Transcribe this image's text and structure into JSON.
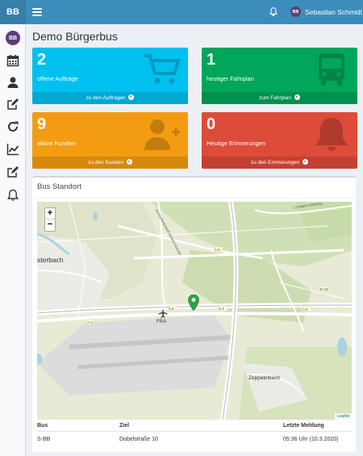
{
  "app": {
    "brand": "BB"
  },
  "topbar": {
    "user_initials": "BB",
    "user_name": "Sebastian Schmidt"
  },
  "sidebar": {
    "avatar_initials": "BB",
    "items": [
      {
        "icon": "calendar-icon"
      },
      {
        "icon": "user-icon"
      },
      {
        "icon": "edit-icon"
      },
      {
        "icon": "refresh-icon"
      },
      {
        "icon": "line-chart-icon"
      },
      {
        "icon": "edit-icon"
      },
      {
        "icon": "bell-icon"
      }
    ]
  },
  "page": {
    "title": "Demo Bürgerbus"
  },
  "boxes": [
    {
      "count": "2",
      "label": "offene Aufträge",
      "link": "zu den Aufträgen",
      "color": "#00c0ef",
      "icon": "shopping-cart-icon"
    },
    {
      "count": "1",
      "label": "heutiger Fahrplan",
      "link": "zum Fahrplan",
      "color": "#00a65a",
      "icon": "bus-icon"
    },
    {
      "count": "9",
      "label": "aktive Kunden",
      "link": "zu den Kunden",
      "color": "#f39c12",
      "icon": "user-plus-icon"
    },
    {
      "count": "0",
      "label": "Heutige Erinnerungen",
      "link": "zu den Erinnerungen",
      "color": "#dd4b39",
      "icon": "bell-icon"
    }
  ],
  "bus_panel": {
    "title": "Bus Standort",
    "map": {
      "zoom_in": "+",
      "zoom_out": "−",
      "attribution": "Leaflet",
      "labels": {
        "town": "sterbach",
        "airport": "FRA",
        "district": "Zeppelinheim"
      },
      "road_labels": [
        "A 5",
        "A 3",
        "B 43",
        "A 3",
        "A 5",
        "A 5"
      ],
      "street_labels": [
        "SCHWANHEIMER BAHNSTRASSE",
        "LYONER STRASSE"
      ]
    },
    "table": {
      "headers": [
        "Bus",
        "Ziel",
        "Letzte Meldung"
      ],
      "rows": [
        [
          "S-BB",
          "Dobelstraße 10",
          "05:36 Uhr (10.3.2020)"
        ]
      ]
    }
  }
}
